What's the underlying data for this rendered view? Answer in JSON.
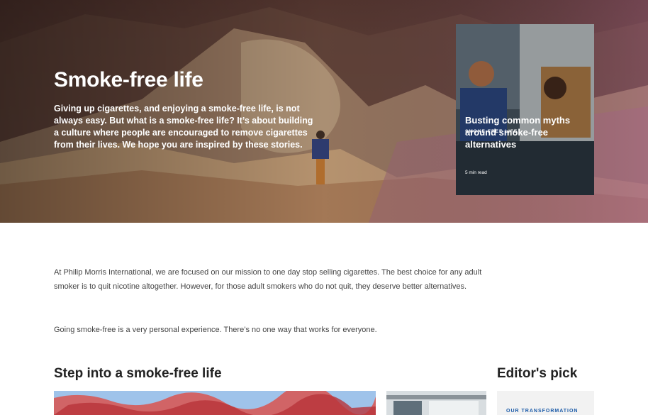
{
  "hero": {
    "title": "Smoke-free life",
    "description": "Giving up cigarettes, and enjoying a smoke-free life, is not always easy. But what is a smoke-free life? It’s about building a culture where people are encouraged to remove cigarettes from their lives. We hope you are inspired by these stories."
  },
  "feature_card": {
    "kicker": "SMOKE-FREE LIFE",
    "title": "Busting common myths around smoke-free alternatives",
    "read_time": "5 min read"
  },
  "intro": {
    "paragraph1": "At Philip Morris International, we are focused on our mission to one day stop selling cigarettes. The best choice for any adult smoker is to quit nicotine altogether. However, for those adult smokers who do not quit, they deserve better alternatives.",
    "paragraph2": "Going smoke-free is a very personal experience. There’s no one way that works for everyone."
  },
  "sections": {
    "step_title": "Step into a smoke-free life",
    "editor_title": "Editor's pick"
  },
  "editor_card": {
    "kicker": "OUR TRANSFORMATION"
  }
}
